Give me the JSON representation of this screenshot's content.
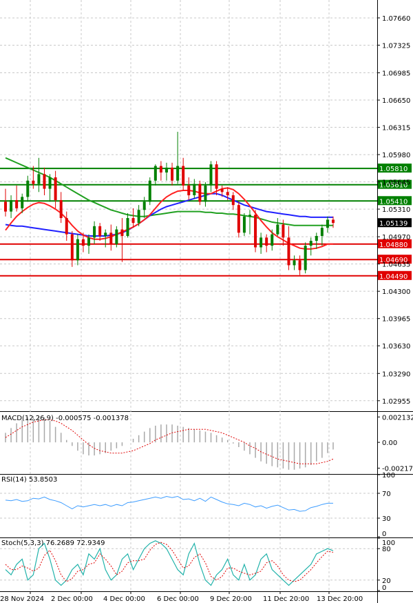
{
  "chart_data": [
    {
      "type": "candlestick",
      "panel": "price",
      "ylim": [
        1.0286,
        1.0788
      ],
      "y_ticks": [
        "1.07660",
        "1.07325",
        "1.06985",
        "1.06650",
        "1.06315",
        "1.05980",
        "1.05645",
        "1.05310",
        "1.04970",
        "1.04635",
        "1.04300",
        "1.03965",
        "1.03630",
        "1.03290",
        "1.02955"
      ],
      "levels": [
        {
          "value": 1.0581,
          "label": "1.05810",
          "color": "#008000"
        },
        {
          "value": 1.0561,
          "label": "1.05610",
          "color": "#008000"
        },
        {
          "value": 1.0541,
          "label": "1.05410",
          "color": "#008000"
        },
        {
          "value": 1.0488,
          "label": "1.04880",
          "color": "#e00000"
        },
        {
          "value": 1.0469,
          "label": "1.04690",
          "color": "#e00000"
        },
        {
          "value": 1.0449,
          "label": "1.04490",
          "color": "#e00000"
        }
      ],
      "last_price": {
        "value": 1.05139,
        "label": "1.05139"
      },
      "candles": [
        {
          "o": 1.054,
          "h": 1.0556,
          "l": 1.0522,
          "c": 1.0528
        },
        {
          "o": 1.0528,
          "h": 1.0548,
          "l": 1.052,
          "c": 1.0542
        },
        {
          "o": 1.0542,
          "h": 1.056,
          "l": 1.0528,
          "c": 1.0532
        },
        {
          "o": 1.0532,
          "h": 1.055,
          "l": 1.0526,
          "c": 1.0546
        },
        {
          "o": 1.0546,
          "h": 1.0572,
          "l": 1.054,
          "c": 1.0566
        },
        {
          "o": 1.0566,
          "h": 1.0584,
          "l": 1.0556,
          "c": 1.0562
        },
        {
          "o": 1.0562,
          "h": 1.0594,
          "l": 1.0552,
          "c": 1.0574
        },
        {
          "o": 1.0574,
          "h": 1.0582,
          "l": 1.0548,
          "c": 1.0556
        },
        {
          "o": 1.0556,
          "h": 1.0574,
          "l": 1.054,
          "c": 1.057
        },
        {
          "o": 1.057,
          "h": 1.0578,
          "l": 1.0532,
          "c": 1.0542
        },
        {
          "o": 1.0542,
          "h": 1.0552,
          "l": 1.0514,
          "c": 1.052
        },
        {
          "o": 1.052,
          "h": 1.0528,
          "l": 1.0492,
          "c": 1.05
        },
        {
          "o": 1.05,
          "h": 1.0504,
          "l": 1.046,
          "c": 1.0468
        },
        {
          "o": 1.0468,
          "h": 1.05,
          "l": 1.0462,
          "c": 1.0494
        },
        {
          "o": 1.0494,
          "h": 1.0502,
          "l": 1.0478,
          "c": 1.0486
        },
        {
          "o": 1.0486,
          "h": 1.05,
          "l": 1.0476,
          "c": 1.0496
        },
        {
          "o": 1.0496,
          "h": 1.0516,
          "l": 1.0488,
          "c": 1.051
        },
        {
          "o": 1.051,
          "h": 1.0514,
          "l": 1.0492,
          "c": 1.0498
        },
        {
          "o": 1.0498,
          "h": 1.0506,
          "l": 1.0484,
          "c": 1.0502
        },
        {
          "o": 1.0502,
          "h": 1.0512,
          "l": 1.048,
          "c": 1.0488
        },
        {
          "o": 1.0488,
          "h": 1.051,
          "l": 1.0484,
          "c": 1.0506
        },
        {
          "o": 1.0506,
          "h": 1.052,
          "l": 1.0466,
          "c": 1.0498
        },
        {
          "o": 1.0498,
          "h": 1.0526,
          "l": 1.0496,
          "c": 1.052
        },
        {
          "o": 1.052,
          "h": 1.0532,
          "l": 1.0508,
          "c": 1.0514
        },
        {
          "o": 1.0514,
          "h": 1.0536,
          "l": 1.051,
          "c": 1.053
        },
        {
          "o": 1.053,
          "h": 1.0546,
          "l": 1.052,
          "c": 1.054
        },
        {
          "o": 1.054,
          "h": 1.057,
          "l": 1.0536,
          "c": 1.0566
        },
        {
          "o": 1.0566,
          "h": 1.0586,
          "l": 1.056,
          "c": 1.0584
        },
        {
          "o": 1.0584,
          "h": 1.059,
          "l": 1.0566,
          "c": 1.0576
        },
        {
          "o": 1.0576,
          "h": 1.0588,
          "l": 1.0566,
          "c": 1.0582
        },
        {
          "o": 1.0582,
          "h": 1.0588,
          "l": 1.056,
          "c": 1.0566
        },
        {
          "o": 1.0566,
          "h": 1.0626,
          "l": 1.0562,
          "c": 1.0584
        },
        {
          "o": 1.0584,
          "h": 1.0594,
          "l": 1.0554,
          "c": 1.056
        },
        {
          "o": 1.056,
          "h": 1.057,
          "l": 1.0542,
          "c": 1.0548
        },
        {
          "o": 1.0548,
          "h": 1.0568,
          "l": 1.0544,
          "c": 1.0562
        },
        {
          "o": 1.0562,
          "h": 1.0566,
          "l": 1.0536,
          "c": 1.054
        },
        {
          "o": 1.054,
          "h": 1.0564,
          "l": 1.0534,
          "c": 1.056
        },
        {
          "o": 1.056,
          "h": 1.059,
          "l": 1.0552,
          "c": 1.0586
        },
        {
          "o": 1.0586,
          "h": 1.059,
          "l": 1.0548,
          "c": 1.0556
        },
        {
          "o": 1.0556,
          "h": 1.056,
          "l": 1.0546,
          "c": 1.0552
        },
        {
          "o": 1.0552,
          "h": 1.0558,
          "l": 1.0542,
          "c": 1.0548
        },
        {
          "o": 1.0548,
          "h": 1.0552,
          "l": 1.053,
          "c": 1.0536
        },
        {
          "o": 1.0536,
          "h": 1.054,
          "l": 1.0496,
          "c": 1.0502
        },
        {
          "o": 1.0502,
          "h": 1.0526,
          "l": 1.0498,
          "c": 1.0522
        },
        {
          "o": 1.0522,
          "h": 1.053,
          "l": 1.05,
          "c": 1.0524
        },
        {
          "o": 1.0524,
          "h": 1.053,
          "l": 1.0478,
          "c": 1.0484
        },
        {
          "o": 1.0484,
          "h": 1.0502,
          "l": 1.0476,
          "c": 1.0496
        },
        {
          "o": 1.0496,
          "h": 1.05,
          "l": 1.0478,
          "c": 1.0486
        },
        {
          "o": 1.0486,
          "h": 1.0506,
          "l": 1.048,
          "c": 1.05
        },
        {
          "o": 1.05,
          "h": 1.052,
          "l": 1.0498,
          "c": 1.0512
        },
        {
          "o": 1.0512,
          "h": 1.0518,
          "l": 1.0486,
          "c": 1.0496
        },
        {
          "o": 1.0496,
          "h": 1.051,
          "l": 1.0456,
          "c": 1.0462
        },
        {
          "o": 1.0462,
          "h": 1.0474,
          "l": 1.0456,
          "c": 1.0468
        },
        {
          "o": 1.0468,
          "h": 1.0474,
          "l": 1.045,
          "c": 1.0456
        },
        {
          "o": 1.0456,
          "h": 1.049,
          "l": 1.0452,
          "c": 1.0486
        },
        {
          "o": 1.0486,
          "h": 1.0496,
          "l": 1.0474,
          "c": 1.0492
        },
        {
          "o": 1.0492,
          "h": 1.0502,
          "l": 1.0482,
          "c": 1.0498
        },
        {
          "o": 1.0498,
          "h": 1.0512,
          "l": 1.0486,
          "c": 1.0508
        },
        {
          "o": 1.0508,
          "h": 1.0522,
          "l": 1.0502,
          "c": 1.0518
        },
        {
          "o": 1.0518,
          "h": 1.0522,
          "l": 1.0508,
          "c": 1.0514
        }
      ],
      "ma_red": [
        1.0505,
        1.0514,
        1.0522,
        1.0528,
        1.0533,
        1.0537,
        1.0539,
        1.0538,
        1.0535,
        1.0531,
        1.0526,
        1.0519,
        1.0511,
        1.0504,
        1.0499,
        1.0496,
        1.0494,
        1.0494,
        1.0495,
        1.0497,
        1.05,
        1.0503,
        1.0506,
        1.0509,
        1.0513,
        1.0518,
        1.0524,
        1.0532,
        1.054,
        1.0546,
        1.055,
        1.0553,
        1.0554,
        1.0554,
        1.0553,
        1.0551,
        1.055,
        1.055,
        1.0553,
        1.0556,
        1.0557,
        1.0555,
        1.055,
        1.0543,
        1.0535,
        1.0526,
        1.0517,
        1.0509,
        1.0502,
        1.0497,
        1.0493,
        1.0489,
        1.0486,
        1.0483,
        1.0482,
        1.0482,
        1.0483,
        1.0485,
        1.0488,
        1.0488
      ],
      "ma_green": [
        1.0594,
        1.0591,
        1.0588,
        1.0585,
        1.0582,
        1.0579,
        1.0576,
        1.0573,
        1.057,
        1.0566,
        1.0562,
        1.0558,
        1.0554,
        1.055,
        1.0546,
        1.0542,
        1.0539,
        1.0536,
        1.0533,
        1.053,
        1.0528,
        1.0526,
        1.0524,
        1.0523,
        1.0522,
        1.0522,
        1.0523,
        1.0524,
        1.0525,
        1.0526,
        1.0527,
        1.0528,
        1.0528,
        1.0528,
        1.0528,
        1.0528,
        1.0527,
        1.0527,
        1.0526,
        1.0526,
        1.0525,
        1.0525,
        1.0524,
        1.0523,
        1.0522,
        1.0521,
        1.0519,
        1.0517,
        1.0515,
        1.0514,
        1.0513,
        1.0512,
        1.0511,
        1.0511,
        1.0511,
        1.0511,
        1.0511,
        1.0511,
        1.0511,
        1.0511
      ],
      "ma_blue": [
        1.0512,
        1.0511,
        1.051,
        1.051,
        1.0509,
        1.0508,
        1.0507,
        1.0506,
        1.0505,
        1.0504,
        1.0503,
        1.0502,
        1.0501,
        1.05,
        1.0499,
        1.0498,
        1.0498,
        1.0498,
        1.0498,
        1.0499,
        1.05,
        1.0502,
        1.0505,
        1.0509,
        1.0513,
        1.0518,
        1.0523,
        1.0527,
        1.0531,
        1.0534,
        1.0536,
        1.0538,
        1.054,
        1.0542,
        1.0544,
        1.0546,
        1.0548,
        1.055,
        1.055,
        1.0548,
        1.0545,
        1.0542,
        1.0539,
        1.0536,
        1.0534,
        1.0532,
        1.053,
        1.0528,
        1.0527,
        1.0526,
        1.0525,
        1.0524,
        1.0523,
        1.0522,
        1.0522,
        1.0521,
        1.0521,
        1.0521,
        1.0521,
        1.0521
      ]
    },
    {
      "type": "histogram",
      "panel": "macd",
      "title": "MACD(12,26,9) -0.000575 -0.001378",
      "ylim": [
        -0.0026,
        0.0025
      ],
      "y_ticks": [
        "0.002132",
        "0.00",
        "-0.002172"
      ],
      "histogram": [
        0.0008,
        0.0012,
        0.0016,
        0.0019,
        0.0021,
        0.0022,
        0.0022,
        0.0021,
        0.0018,
        0.0013,
        0.0008,
        0.0002,
        -0.0003,
        -0.0007,
        -0.001,
        -0.0011,
        -0.0011,
        -0.001,
        -0.0009,
        -0.0007,
        -0.0005,
        -0.0003,
        0.0,
        0.0003,
        0.0006,
        0.0009,
        0.0012,
        0.0014,
        0.0015,
        0.0015,
        0.0015,
        0.0014,
        0.0013,
        0.0012,
        0.0011,
        0.001,
        0.0009,
        0.0008,
        0.0006,
        0.0004,
        0.0002,
        -0.0001,
        -0.0004,
        -0.0007,
        -0.001,
        -0.0013,
        -0.0016,
        -0.0018,
        -0.002,
        -0.0021,
        -0.0022,
        -0.0023,
        -0.0023,
        -0.0022,
        -0.0021,
        -0.0019,
        -0.0016,
        -0.0013,
        -0.0009,
        -0.0006
      ],
      "signal": [
        0.0004,
        0.0007,
        0.001,
        0.0013,
        0.0015,
        0.0017,
        0.0018,
        0.0019,
        0.0019,
        0.0018,
        0.0016,
        0.0013,
        0.001,
        0.0006,
        0.0002,
        -0.0002,
        -0.0005,
        -0.0007,
        -0.0008,
        -0.0009,
        -0.0009,
        -0.0009,
        -0.0008,
        -0.0007,
        -0.0005,
        -0.0003,
        -0.0001,
        0.0002,
        0.0004,
        0.0006,
        0.0008,
        0.0009,
        0.001,
        0.0011,
        0.0011,
        0.0011,
        0.0011,
        0.001,
        0.0009,
        0.0008,
        0.0006,
        0.0004,
        0.0002,
        0.0,
        -0.0003,
        -0.0005,
        -0.0008,
        -0.001,
        -0.0012,
        -0.0014,
        -0.0015,
        -0.0016,
        -0.0017,
        -0.0018,
        -0.0018,
        -0.0018,
        -0.0018,
        -0.0017,
        -0.0016,
        -0.0014
      ]
    },
    {
      "type": "line",
      "panel": "rsi",
      "title": "RSI(14) 53.8503",
      "ylim": [
        0,
        100
      ],
      "y_ticks": [
        "100",
        "70",
        "30",
        "0"
      ],
      "values": [
        59,
        58,
        60,
        57,
        58,
        62,
        61,
        64,
        60,
        58,
        55,
        50,
        45,
        50,
        48,
        50,
        52,
        50,
        52,
        49,
        52,
        50,
        55,
        56,
        58,
        60,
        62,
        64,
        62,
        65,
        63,
        65,
        60,
        61,
        58,
        62,
        57,
        64,
        60,
        56,
        53,
        52,
        50,
        54,
        52,
        48,
        50,
        46,
        49,
        51,
        47,
        43,
        44,
        41,
        42,
        47,
        49,
        52,
        54,
        54
      ]
    },
    {
      "type": "line",
      "panel": "stoch",
      "title": "Stoch(5,3,3) 76.2689 72.9349",
      "ylim": [
        0,
        100
      ],
      "y_ticks": [
        "100",
        "80",
        "20",
        "0"
      ],
      "k": [
        40,
        30,
        50,
        60,
        20,
        30,
        80,
        90,
        60,
        20,
        10,
        20,
        40,
        50,
        30,
        70,
        60,
        80,
        40,
        20,
        30,
        60,
        70,
        40,
        60,
        80,
        90,
        95,
        90,
        80,
        60,
        40,
        30,
        70,
        90,
        50,
        20,
        10,
        30,
        40,
        60,
        30,
        20,
        50,
        20,
        30,
        60,
        70,
        40,
        30,
        20,
        10,
        20,
        30,
        40,
        50,
        70,
        75,
        80,
        76
      ],
      "d": [
        50,
        40,
        40,
        47,
        43,
        37,
        43,
        67,
        77,
        57,
        30,
        17,
        23,
        37,
        40,
        50,
        53,
        70,
        60,
        47,
        30,
        37,
        53,
        57,
        57,
        60,
        77,
        88,
        92,
        88,
        77,
        60,
        43,
        47,
        63,
        70,
        53,
        27,
        20,
        27,
        43,
        43,
        37,
        33,
        30,
        33,
        37,
        53,
        57,
        47,
        30,
        20,
        17,
        20,
        30,
        40,
        53,
        65,
        75,
        73
      ]
    }
  ],
  "x_labels": [
    "28 Nov 2024",
    "2 Dec 00:00",
    "4 Dec 00:00",
    "6 Dec 00:00",
    "9 Dec 20:00",
    "11 Dec 20:00",
    "13 Dec 20:00"
  ],
  "colors": {
    "bull": "#008000",
    "bear": "#e00000",
    "ma_red": "#ff2020",
    "ma_green": "#20a020",
    "ma_blue": "#2020ff",
    "grid": "#c8c8c8",
    "hist": "#a8a8a8",
    "macd_signal": "#e00000",
    "rsi_line": "#3c9cff",
    "stoch_k": "#20b2aa",
    "stoch_d": "#e00000"
  }
}
